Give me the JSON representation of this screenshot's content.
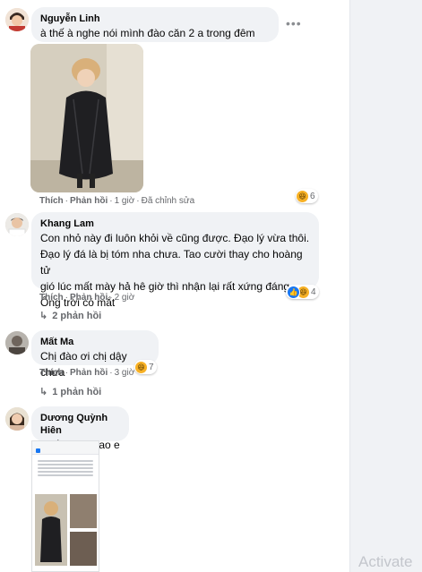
{
  "colors": {
    "bubble": "#f0f2f5",
    "link": "#65676b",
    "accent": "#1877f2",
    "haha": "#f7b125"
  },
  "watermark": "Activate",
  "comments": [
    {
      "name": "Nguyễn Linh",
      "text": [
        "à thế à nghe nói mình đào căn 2 a trong đêm :)))"
      ],
      "actions": {
        "like": "Thích",
        "reply": "Phản hồi",
        "time": "1 giờ",
        "edited": "Đã chỉnh sửa"
      },
      "reactions": {
        "icons": [
          "haha-icon"
        ],
        "count": "6"
      },
      "more_icon": "more-icon"
    },
    {
      "name": "Khang Lam",
      "text": [
        "Con nhỏ này đi luôn khỏi về cũng được. Đạo lý vừa thôi.",
        "Đạo lý đá là bị tóm nha chưa. Tao cười thay cho hoàng tử",
        "gió lúc mất mày hả hê giờ thì nhận lại rất xứng đáng.",
        "Ông trời có mắt"
      ],
      "actions": {
        "like": "Thích",
        "reply": "Phản hồi",
        "time": "2 giờ"
      },
      "reactions": {
        "icons": [
          "like-icon",
          "haha-icon"
        ],
        "count": "4"
      },
      "replies": "2 phản hồi"
    },
    {
      "name": "Mất Ma",
      "text": [
        "Chị đào ơi chị dậy chưa"
      ],
      "actions": {
        "like": "Thích",
        "reply": "Phản hồi",
        "time": "3 giờ"
      },
      "reactions": {
        "icons": [
          "haha-icon"
        ],
        "count": "7"
      },
      "replies": "1 phản hồi"
    },
    {
      "name": "Dương Quỳnh Hiên",
      "text": [
        "Thế này là sao e"
      ]
    }
  ]
}
